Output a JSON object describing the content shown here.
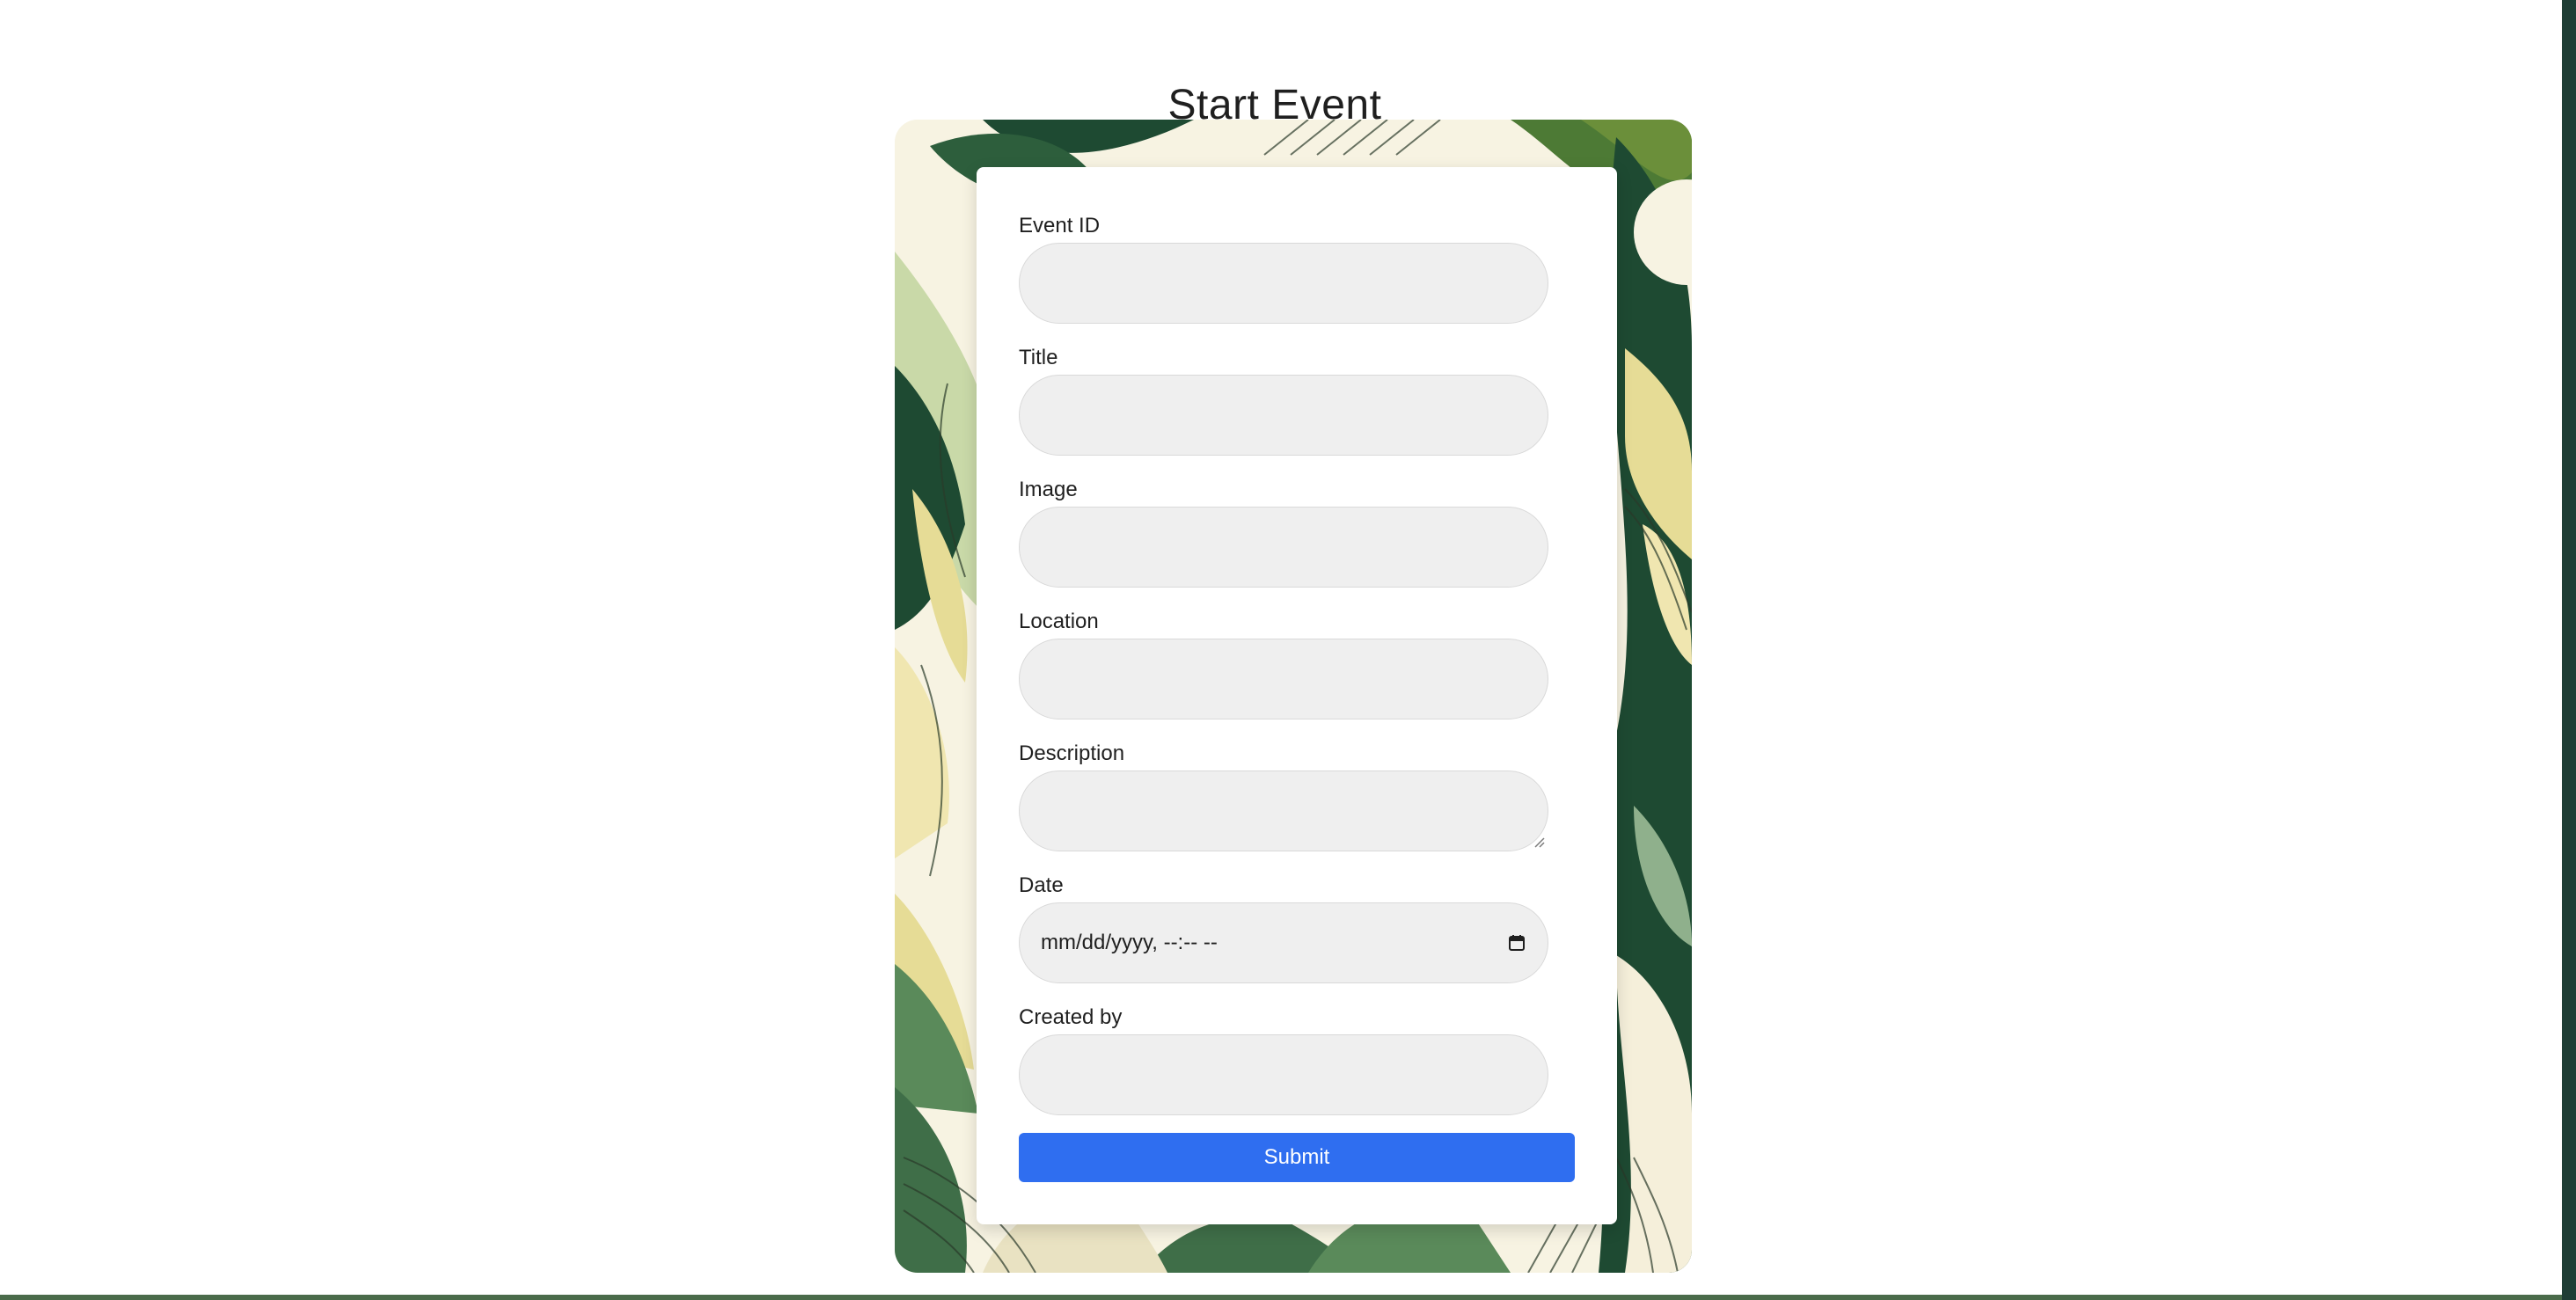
{
  "page": {
    "title": "Start Event"
  },
  "form": {
    "fields": [
      {
        "label": "Event ID",
        "value": ""
      },
      {
        "label": "Title",
        "value": ""
      },
      {
        "label": "Image",
        "value": ""
      },
      {
        "label": "Location",
        "value": ""
      },
      {
        "label": "Description",
        "value": ""
      },
      {
        "label": "Date",
        "placeholder": "mm/dd/yyyy, --:-- --"
      },
      {
        "label": "Created by",
        "value": ""
      }
    ],
    "submit_label": "Submit"
  },
  "colors": {
    "accent": "#2f6ef0",
    "input_bg": "#efefef",
    "leaf_dark": "#1e4a32",
    "leaf_mid": "#5a8a5a",
    "leaf_light": "#c9d9a8",
    "cream": "#f7f3e2",
    "yellow": "#e6dc96"
  },
  "icons": {
    "date_picker": "calendar-icon"
  }
}
